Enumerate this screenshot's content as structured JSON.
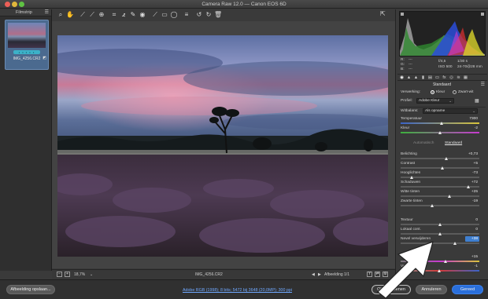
{
  "window": {
    "title": "Camera Raw 12.0 — Canon EOS 6D"
  },
  "toolbar": {
    "tools": [
      "zoom-icon",
      "hand-icon",
      "white-balance-icon",
      "color-sampler-icon",
      "target-adjust-icon",
      "crop-icon",
      "straighten-icon",
      "spot-removal-icon",
      "red-eye-icon",
      "adjustment-brush-icon",
      "graduated-filter-icon",
      "radial-filter-icon",
      "preferences-icon",
      "list-icon",
      "rotate-left-icon",
      "rotate-right-icon",
      "trash-icon"
    ]
  },
  "filmstrip": {
    "title": "Filmstrip",
    "thumb_name": "IMG_4256.CR2",
    "rating": "• • • • •"
  },
  "status": {
    "zoom": "18,7%",
    "filename": "IMG_4256.CR2",
    "counter": "Afbeelding 1/1"
  },
  "exif": {
    "r": "R:",
    "r_val": "---",
    "g": "G:",
    "g_val": "---",
    "b": "B:",
    "b_val": "---",
    "aperture": "f/4,5",
    "shutter": "1/30 s",
    "iso": "ISO 500",
    "lens": "24-70@28 mm"
  },
  "panel": {
    "title": "Standaard",
    "treatment_label": "Verwerking:",
    "treatment_color": "Kleur",
    "treatment_bw": "Zwart-wit",
    "profile_label": "Profiel:",
    "profile_value": "Adobe Kleur",
    "wb_label": "Witbalans:",
    "wb_value": "Als opname",
    "temp_label": "Temperatuur",
    "temp_value": "7300",
    "tint_label": "Kleur",
    "tint_value": "-2",
    "auto_link": "Automatisch",
    "default_link": "Standaard",
    "sliders": [
      {
        "label": "Belichting",
        "value": "+0,73",
        "pos": 0.58
      },
      {
        "label": "Contrast",
        "value": "+5",
        "pos": 0.53
      },
      {
        "label": "Hooglichten",
        "value": "-73",
        "pos": 0.14
      },
      {
        "label": "Schaduwen",
        "value": "+72",
        "pos": 0.86
      },
      {
        "label": "Witte tinten",
        "value": "+25",
        "pos": 0.62
      },
      {
        "label": "Zwarte tinten",
        "value": "-19",
        "pos": 0.4
      },
      {
        "label": "Textuur",
        "value": "0",
        "pos": 0.5
      },
      {
        "label": "Lokaal cont.",
        "value": "0",
        "pos": 0.5
      },
      {
        "label": "Nevel verwijderen",
        "value": "+38",
        "pos": 0.69
      },
      {
        "label": "Levendigheid",
        "value": "+15",
        "pos": 0.57
      },
      {
        "label": "Verzadiging",
        "value": "-1",
        "pos": 0.49
      }
    ]
  },
  "bottom": {
    "save_button": "Afbeelding opslaan...",
    "workflow_link": "Adobe RGB (1998); 8 bits; 5472 bij 3648 (20,0MP); 300 ppi",
    "open_button": "Object openen",
    "cancel_button": "Annuleren",
    "done_button": "Gereed"
  },
  "colors": {
    "accent": "#2a6fdb",
    "selection": "#3f7fd0",
    "rating_bar": "#3cb1c8"
  }
}
